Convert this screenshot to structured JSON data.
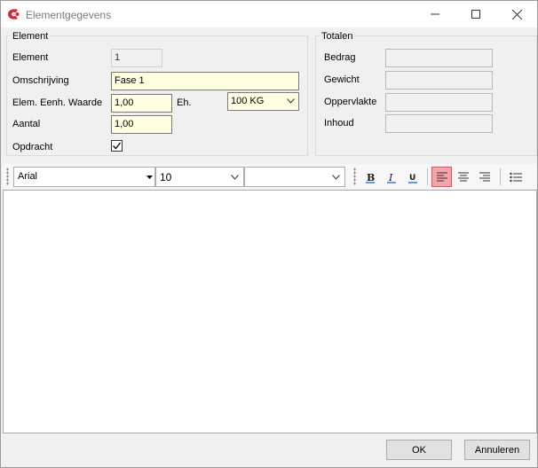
{
  "window": {
    "title": "Elementgegevens",
    "accent_color": "#e0242c"
  },
  "element_group": {
    "legend": "Element",
    "element_label": "Element",
    "element_value": "1",
    "omschrijving_label": "Omschrijving",
    "omschrijving_value": "Fase 1",
    "waarde_label": "Elem. Eenh. Waarde",
    "waarde_value": "1,00",
    "eenheid_label": "Eh.",
    "eenheid_value": "100 KG",
    "aantal_label": "Aantal",
    "aantal_value": "1,00",
    "opdracht_label": "Opdracht",
    "opdracht_checked": true
  },
  "totals_group": {
    "legend": "Totalen",
    "bedrag_label": "Bedrag",
    "gewicht_label": "Gewicht",
    "oppervlakte_label": "Oppervlakte",
    "inhoud_label": "Inhoud"
  },
  "toolbar": {
    "font_name": "Arial",
    "font_size": "10",
    "style_value": "",
    "active_button_color": "#f4a3a8"
  },
  "editor": {
    "content": ""
  },
  "buttons": {
    "ok": "OK",
    "cancel": "Annuleren"
  }
}
